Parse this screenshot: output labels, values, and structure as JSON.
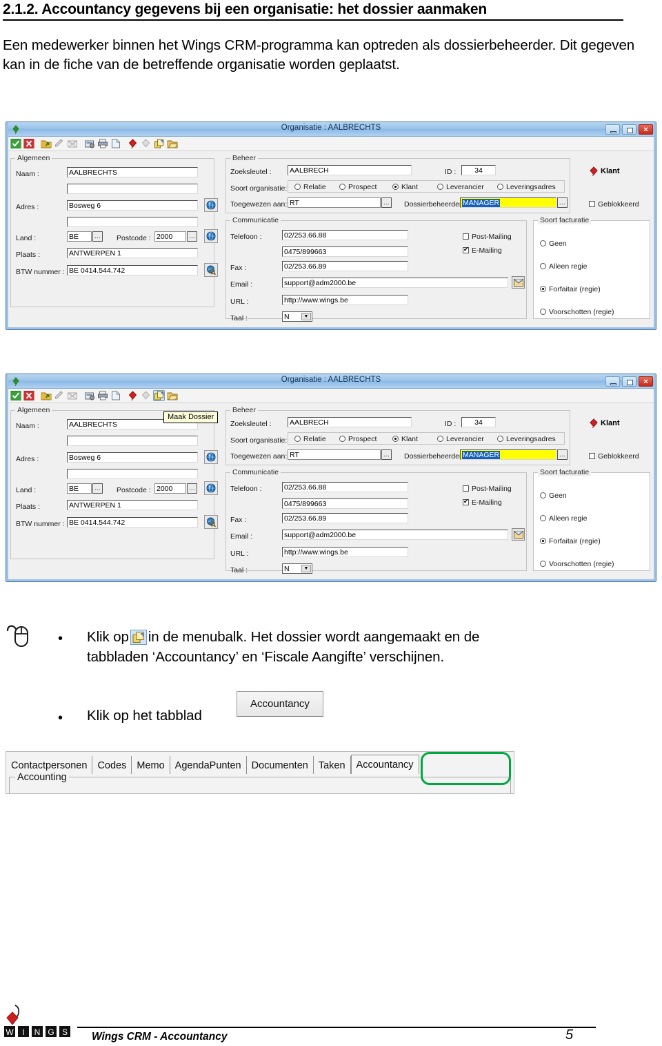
{
  "document": {
    "heading": "2.1.2. Accountancy gegevens bij een organisatie: het dossier aanmaken",
    "paragraph": "Een medewerker binnen het Wings CRM-programma kan optreden als dossierbeheerder.  Dit gegeven kan in de fiche van de betreffende organisatie worden geplaatst."
  },
  "dialog": {
    "title": "Organisatie : AALBRECHTS",
    "window_buttons": {
      "minimize": "–",
      "maximize": "❐",
      "close": "✕"
    },
    "toolbar_icons": [
      "confirm-check-icon",
      "cancel-cross-icon",
      "export-folder-icon",
      "edit-pencil-icon",
      "delete-envelope-icon",
      "properties-icon",
      "print-icon",
      "new-document-icon",
      "kite-red-icon",
      "kite-grey-icon",
      "maak-dossier-icon",
      "open-folder-icon"
    ],
    "tooltip": "Maak Dossier",
    "algemeen": {
      "group_title": "Algemeen",
      "naam_label": "Naam :",
      "naam_value": "AALBRECHTS",
      "naam2_value": "",
      "adres_label": "Adres :",
      "adres_value": "Bosweg 6",
      "adres2_value": "",
      "land_label": "Land :",
      "land_value": "BE",
      "postcode_label": "Postcode :",
      "postcode_value": "2000",
      "plaats_label": "Plaats :",
      "plaats_value": "ANTWERPEN 1",
      "btw_label": "BTW nummer :",
      "btw_value": "BE 0414.544.742",
      "dots_button": "..."
    },
    "beheer": {
      "group_title": "Beheer",
      "zoeksleutel_label": "Zoeksleutel :",
      "zoeksleutel_value": "AALBRECH",
      "id_label": "ID :",
      "id_value": "34",
      "klant_tag": "Klant",
      "soort_label": "Soort organisatie:",
      "soort_options": [
        "Relatie",
        "Prospect",
        "Klant",
        "Leverancier",
        "Leveringsadres"
      ],
      "soort_selected": "Klant",
      "toegewezen_label": "Toegewezen aan:",
      "toegewezen_value": "RT",
      "dossierbeheerder_label": "Dossierbeheerder:",
      "dossierbeheerder_value": "MANAGER",
      "geblokkeerd_label": "Geblokkeerd",
      "geblokkeerd_checked": false
    },
    "communicatie": {
      "group_title": "Communicatie",
      "telefoon_label": "Telefoon :",
      "telefoon_value": "02/253.66.88",
      "telefoon2_value": "0475/899663",
      "fax_label": "Fax :",
      "fax_value": "02/253.66.89",
      "email_label": "Email :",
      "email_value": "support@adm2000.be",
      "url_label": "URL :",
      "url_value": "http://www.wings.be",
      "taal_label": "Taal :",
      "taal_value": "N",
      "post_mailing_label": "Post-Mailing",
      "post_mailing_checked": false,
      "email_mailing_label": "E-Mailing",
      "email_mailing_checked": true
    },
    "facturatie": {
      "group_title": "Soort facturatie",
      "options": [
        "Geen",
        "Alleen regie",
        "Forfaitair (regie)",
        "Voorschotten (regie)"
      ],
      "selected": "Forfaitair (regie)"
    }
  },
  "instructions": {
    "bullet": "•",
    "step1_before": "Klik op",
    "step1_after": "in de menubalk.  Het dossier wordt aangemaakt en de",
    "step1_line2": "tabbladen ‘Accountancy’ en ‘Fiscale Aangifte’ verschijnen.",
    "step2_text": "Klik op het tabblad",
    "step2_button": "Accountancy"
  },
  "tabstrip": {
    "tabs": [
      "Contactpersonen",
      "Codes",
      "Memo",
      "AgendaPunten",
      "Documenten",
      "Taken",
      "Accountancy"
    ],
    "active_tab": "Accountancy",
    "group_label": "Accounting",
    "highlight_color": "#00a83f"
  },
  "footer": {
    "logo_letters": [
      "W",
      "I",
      "N",
      "G",
      "S"
    ],
    "text": "Wings CRM - Accountancy",
    "page_number": "5"
  }
}
